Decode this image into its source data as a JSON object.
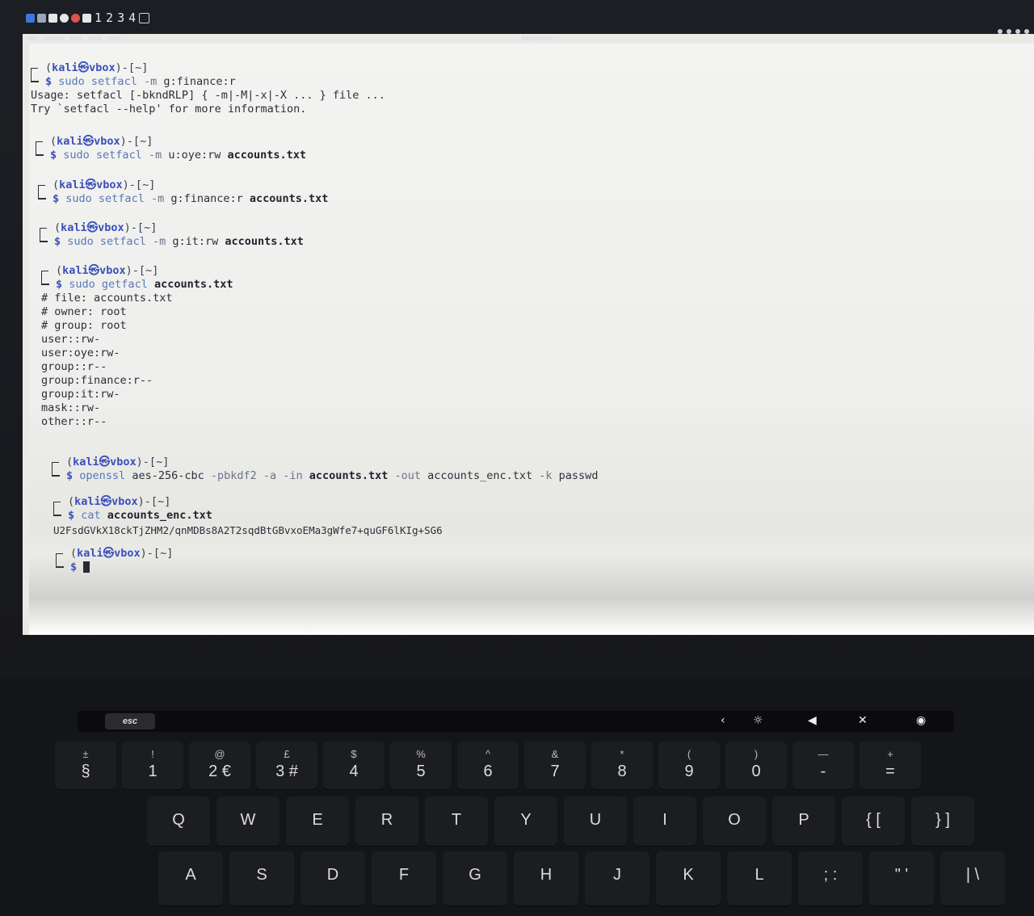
{
  "topbar": {
    "workspaces": [
      "1",
      "2",
      "3",
      "4"
    ],
    "menu": [
      "File",
      "Actions",
      "Edit",
      "View",
      "Help"
    ],
    "window_title": "kali@vbox: ~"
  },
  "prompt": {
    "user": "kali",
    "symbol": "㉿",
    "host": "vbox",
    "path": "~",
    "dollar": "$"
  },
  "terminal": {
    "c1": {
      "cmd": "sudo",
      "rest": " setfacl",
      "opt": " -m",
      "arg": " g:finance:r"
    },
    "usage1": "Usage: setfacl [-bkndRLP] { -m|-M|-x|-X ... } file ...",
    "usage2": "Try `setfacl --help' for more information.",
    "c2": {
      "cmd": "sudo",
      "rest": " setfacl",
      "opt": " -m",
      "arg": " u:oye:rw",
      "file": " accounts.txt"
    },
    "c3": {
      "cmd": "sudo",
      "rest": " setfacl",
      "opt": " -m",
      "arg": " g:finance:r",
      "file": " accounts.txt"
    },
    "c4": {
      "cmd": "sudo",
      "rest": " setfacl",
      "opt": " -m",
      "arg": " g:it:rw",
      "file": " accounts.txt"
    },
    "c5": {
      "cmd": "sudo",
      "rest": " getfacl",
      "file": " accounts.txt"
    },
    "acl_output": [
      "# file: accounts.txt",
      "# owner: root",
      "# group: root",
      "user::rw-",
      "user:oye:rw-",
      "group::r--",
      "group:finance:r--",
      "group:it:rw-",
      "mask::rw-",
      "other::r--"
    ],
    "c6": {
      "cmd": "openssl",
      "a": " aes-256-cbc",
      "b": " -pbkdf2",
      "c": " -a",
      "d": " -in",
      "file": " accounts.txt",
      "e": " -out",
      "f": " accounts_enc.txt",
      "g": " -k",
      "h": " passwd"
    },
    "c7": {
      "cmd": "cat",
      "file": " accounts_enc.txt"
    },
    "cipher_output": "U2FsdGVkX18ckTjZHM2/qnMDBs8A2T2sqdBtGBvxoEMa3gWfe7+quGF6lKIg+SG6"
  },
  "keyboard": {
    "esc": "esc",
    "number_row": [
      {
        "top": "±",
        "main": "§"
      },
      {
        "top": "!",
        "main": "1"
      },
      {
        "top": "@",
        "main": "2 €"
      },
      {
        "top": "£",
        "main": "3 #"
      },
      {
        "top": "$",
        "main": "4"
      },
      {
        "top": "%",
        "main": "5"
      },
      {
        "top": "^",
        "main": "6"
      },
      {
        "top": "&",
        "main": "7"
      },
      {
        "top": "*",
        "main": "8"
      },
      {
        "top": "(",
        "main": "9"
      },
      {
        "top": ")",
        "main": "0"
      },
      {
        "top": "—",
        "main": "-"
      },
      {
        "top": "+",
        "main": "="
      }
    ],
    "qwerty_row": [
      "Q",
      "W",
      "E",
      "R",
      "T",
      "Y",
      "U",
      "I",
      "O",
      "P",
      "{ [",
      "} ]"
    ],
    "asdf_row": [
      "A",
      "S",
      "D",
      "F",
      "G",
      "H",
      "J",
      "K",
      "L",
      "; :",
      "\" '",
      "| \\"
    ]
  }
}
